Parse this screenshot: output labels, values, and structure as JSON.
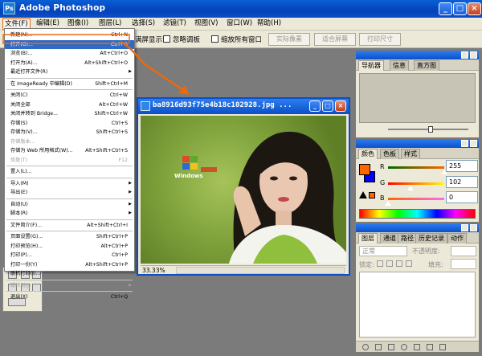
{
  "window": {
    "title": "Adobe Photoshop",
    "app_icon_glyph": "Ps",
    "minimize_glyph": "_",
    "maximize_glyph": "□",
    "close_glyph": "×"
  },
  "menubar": {
    "items": [
      {
        "label": "文件(F)"
      },
      {
        "label": "编辑(E)"
      },
      {
        "label": "图像(I)"
      },
      {
        "label": "图层(L)"
      },
      {
        "label": "选择(S)"
      },
      {
        "label": "滤镜(T)"
      },
      {
        "label": "视图(V)"
      },
      {
        "label": "窗口(W)"
      },
      {
        "label": "帮助(H)"
      }
    ]
  },
  "options": {
    "resize_label": "调整窗口大小以满屏显示",
    "resize_visible": "满屏显示",
    "ignore_palettes": "忽略调板",
    "zoom_all": "缩放所有窗口",
    "actual_pixels": "实际像素",
    "fit_screen": "适合屏幕",
    "print_size": "打印尺寸"
  },
  "filemenu": {
    "items": [
      {
        "label": "新建(N)...",
        "shortcut": "Ctrl+N"
      },
      {
        "label": "打开(O)...",
        "shortcut": "Ctrl+O",
        "highlight": true
      },
      {
        "label": "浏览(B)...",
        "shortcut": "Alt+Ctrl+O"
      },
      {
        "label": "打开为(A)...",
        "shortcut": "Alt+Shift+Ctrl+O"
      },
      {
        "label": "最近打开文件(R)",
        "shortcut": "",
        "submenu": true
      },
      {
        "sep": true
      },
      {
        "label": "在 ImageReady 中编辑(D)",
        "shortcut": "Shift+Ctrl+M"
      },
      {
        "sep": true
      },
      {
        "label": "关闭(C)",
        "shortcut": "Ctrl+W"
      },
      {
        "label": "关闭全部",
        "shortcut": "Alt+Ctrl+W"
      },
      {
        "label": "关闭并转到 Bridge...",
        "shortcut": "Shift+Ctrl+W"
      },
      {
        "label": "存储(S)",
        "shortcut": "Ctrl+S"
      },
      {
        "label": "存储为(V)...",
        "shortcut": "Shift+Ctrl+S"
      },
      {
        "label": "存储版本...",
        "shortcut": "",
        "disabled": true
      },
      {
        "label": "存储为 Web 所用格式(W)...",
        "shortcut": "Alt+Shift+Ctrl+S"
      },
      {
        "label": "恢复(T)",
        "shortcut": "F12",
        "disabled": true
      },
      {
        "sep": true
      },
      {
        "label": "置入(L)...",
        "shortcut": ""
      },
      {
        "sep": true
      },
      {
        "label": "导入(M)",
        "shortcut": "",
        "submenu": true
      },
      {
        "label": "导出(E)",
        "shortcut": "",
        "submenu": true
      },
      {
        "sep": true
      },
      {
        "label": "自动(U)",
        "shortcut": "",
        "submenu": true
      },
      {
        "label": "脚本(R)",
        "shortcut": "",
        "submenu": true
      },
      {
        "sep": true
      },
      {
        "label": "文件简介(F)...",
        "shortcut": "Alt+Shift+Ctrl+I"
      },
      {
        "sep": true
      },
      {
        "label": "页面设置(G)...",
        "shortcut": "Shift+Ctrl+P"
      },
      {
        "label": "打印预览(H)...",
        "shortcut": "Alt+Ctrl+P"
      },
      {
        "label": "打印(P)...",
        "shortcut": "Ctrl+P"
      },
      {
        "label": "打印一份(Y)",
        "shortcut": "Alt+Shift+Ctrl+P"
      },
      {
        "label": "联机打印(I)...",
        "shortcut": ""
      },
      {
        "sep": true
      },
      {
        "label": "跳转到(J)",
        "shortcut": "",
        "submenu": true,
        "disabled": true
      },
      {
        "sep": true
      },
      {
        "label": "退出(X)",
        "shortcut": "Ctrl+Q"
      }
    ]
  },
  "document": {
    "title": "ba8916d93f75e4b18c102928.jpg ...",
    "zoom": "33.33%",
    "watermark": "Windows"
  },
  "navigator_panel": {
    "tabs": [
      {
        "label": "导航器"
      },
      {
        "label": "信息"
      },
      {
        "label": "直方图"
      }
    ]
  },
  "color_panel": {
    "tabs": [
      {
        "label": "颜色"
      },
      {
        "label": "色板"
      },
      {
        "label": "样式"
      }
    ],
    "channels": [
      {
        "name": "R",
        "value": "255",
        "level": 1.0
      },
      {
        "name": "G",
        "value": "102",
        "level": 0.4
      },
      {
        "name": "B",
        "value": "0",
        "level": 0.0
      }
    ],
    "foreground_color": "#ff6600",
    "background_color": "#0000ff"
  },
  "layers_panel": {
    "tabs": [
      {
        "label": "图层"
      },
      {
        "label": "通道"
      },
      {
        "label": "路径"
      },
      {
        "label": "历史记录"
      },
      {
        "label": "动作"
      }
    ],
    "blend_mode": "正常",
    "opacity_label": "不透明度:",
    "lock_label": "锁定:",
    "fill_label": "填充:"
  },
  "colors": {
    "accent_orange": "#e86a10",
    "menu_highlight": "#316ac5"
  }
}
